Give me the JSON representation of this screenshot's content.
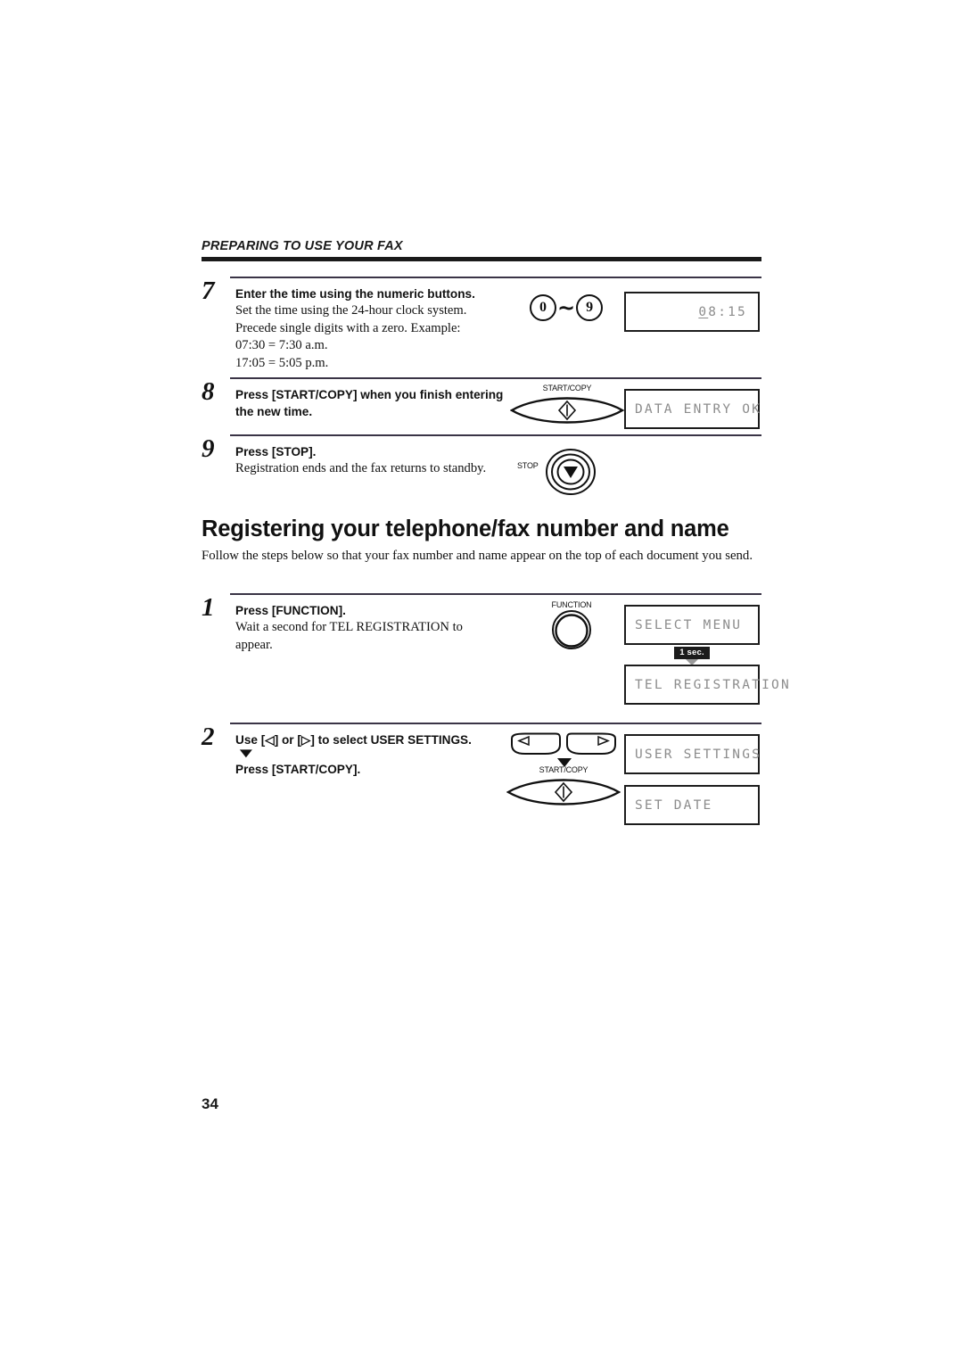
{
  "header": {
    "running_title": "PREPARING TO USE YOUR FAX"
  },
  "page_number": "34",
  "section": {
    "title": "Registering your telephone/fax number and name",
    "intro": "Follow the steps below so that your fax number and name appear on the top of each document you send."
  },
  "steps": [
    {
      "number": "7",
      "title": "Enter the time using the numeric buttons.",
      "desc_lines": [
        "Set the time using the 24-hour clock system.",
        "Precede single digits with a zero. Example:",
        "07:30 = 7:30 a.m.",
        "17:05 = 5:05 p.m."
      ],
      "key_low": "0",
      "key_tilde": "~",
      "key_high": "9",
      "lcd_cursor_char": "0",
      "lcd_rest": "8:15"
    },
    {
      "number": "8",
      "title_line1": "Press [START/COPY] when you finish entering",
      "title_line2": "the new time.",
      "button_caption": "START/COPY",
      "lcd": "DATA ENTRY OK"
    },
    {
      "number": "9",
      "title": "Press [STOP].",
      "desc": "Registration ends and the fax returns to standby.",
      "button_caption": "STOP"
    },
    {
      "number": "1",
      "title": "Press [FUNCTION].",
      "desc_lines": [
        "Wait a second for TEL REGISTRATION to",
        "appear."
      ],
      "button_caption": "FUNCTION",
      "lcd_first": "SELECT MENU",
      "delay_tag": "1 sec.",
      "lcd_second": "TEL REGISTRATION"
    },
    {
      "number": "2",
      "title_line1": "Use [◁] or [▷] to select USER SETTINGS.",
      "arrow_glyph": "▼",
      "title_line2": "Press [START/COPY].",
      "button_caption": "START/COPY",
      "left_arrow_glyph": "◁",
      "right_arrow_glyph": "▷",
      "lcd_first": "USER SETTINGS",
      "lcd_second": "SET DATE"
    }
  ],
  "colors": {
    "ink": "#111111",
    "rule": "#3a3446",
    "lcd_text": "#8c8c8c",
    "tag_bg": "#1c1c1c"
  }
}
